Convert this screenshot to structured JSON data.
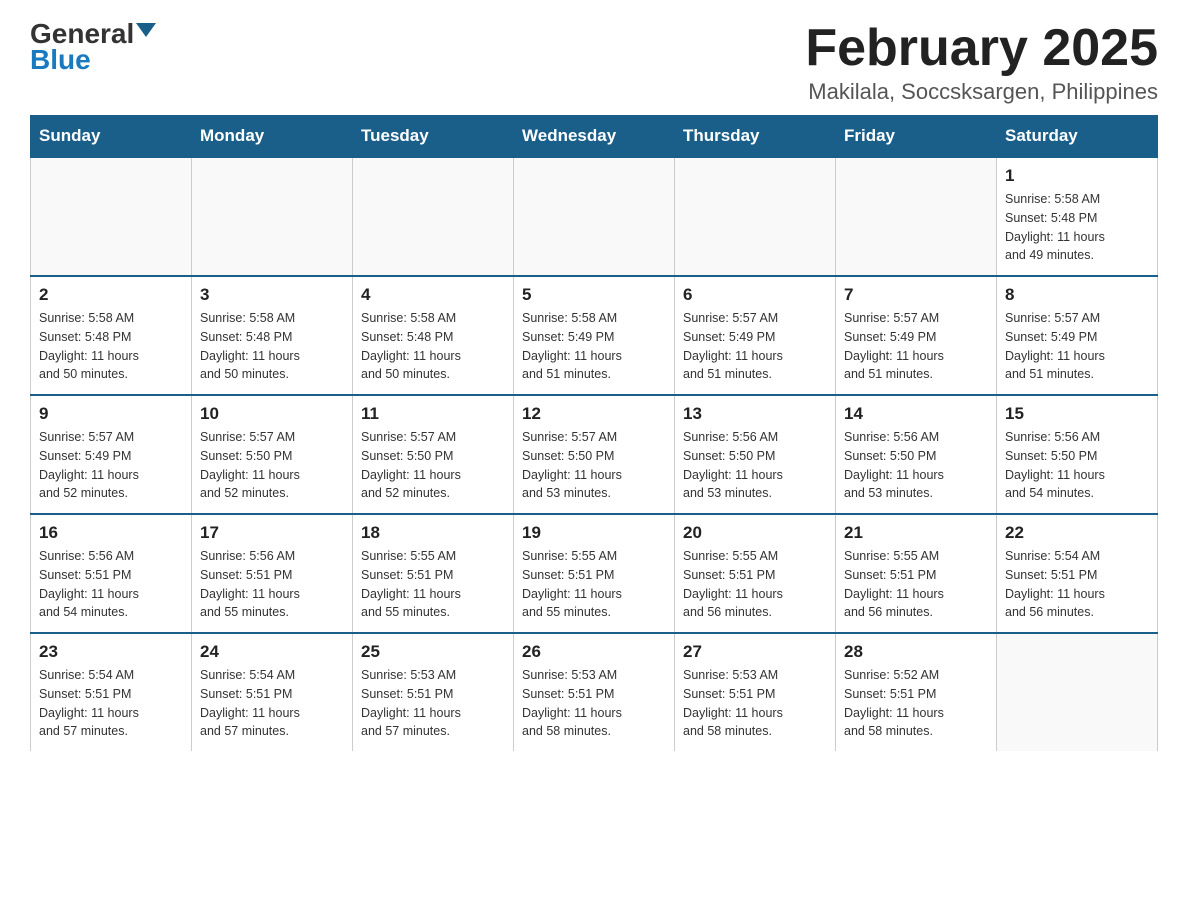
{
  "logo": {
    "general": "General",
    "blue": "Blue"
  },
  "title": "February 2025",
  "location": "Makilala, Soccsksargen, Philippines",
  "days_header": [
    "Sunday",
    "Monday",
    "Tuesday",
    "Wednesday",
    "Thursday",
    "Friday",
    "Saturday"
  ],
  "weeks": [
    [
      {
        "day": "",
        "info": ""
      },
      {
        "day": "",
        "info": ""
      },
      {
        "day": "",
        "info": ""
      },
      {
        "day": "",
        "info": ""
      },
      {
        "day": "",
        "info": ""
      },
      {
        "day": "",
        "info": ""
      },
      {
        "day": "1",
        "info": "Sunrise: 5:58 AM\nSunset: 5:48 PM\nDaylight: 11 hours\nand 49 minutes."
      }
    ],
    [
      {
        "day": "2",
        "info": "Sunrise: 5:58 AM\nSunset: 5:48 PM\nDaylight: 11 hours\nand 50 minutes."
      },
      {
        "day": "3",
        "info": "Sunrise: 5:58 AM\nSunset: 5:48 PM\nDaylight: 11 hours\nand 50 minutes."
      },
      {
        "day": "4",
        "info": "Sunrise: 5:58 AM\nSunset: 5:48 PM\nDaylight: 11 hours\nand 50 minutes."
      },
      {
        "day": "5",
        "info": "Sunrise: 5:58 AM\nSunset: 5:49 PM\nDaylight: 11 hours\nand 51 minutes."
      },
      {
        "day": "6",
        "info": "Sunrise: 5:57 AM\nSunset: 5:49 PM\nDaylight: 11 hours\nand 51 minutes."
      },
      {
        "day": "7",
        "info": "Sunrise: 5:57 AM\nSunset: 5:49 PM\nDaylight: 11 hours\nand 51 minutes."
      },
      {
        "day": "8",
        "info": "Sunrise: 5:57 AM\nSunset: 5:49 PM\nDaylight: 11 hours\nand 51 minutes."
      }
    ],
    [
      {
        "day": "9",
        "info": "Sunrise: 5:57 AM\nSunset: 5:49 PM\nDaylight: 11 hours\nand 52 minutes."
      },
      {
        "day": "10",
        "info": "Sunrise: 5:57 AM\nSunset: 5:50 PM\nDaylight: 11 hours\nand 52 minutes."
      },
      {
        "day": "11",
        "info": "Sunrise: 5:57 AM\nSunset: 5:50 PM\nDaylight: 11 hours\nand 52 minutes."
      },
      {
        "day": "12",
        "info": "Sunrise: 5:57 AM\nSunset: 5:50 PM\nDaylight: 11 hours\nand 53 minutes."
      },
      {
        "day": "13",
        "info": "Sunrise: 5:56 AM\nSunset: 5:50 PM\nDaylight: 11 hours\nand 53 minutes."
      },
      {
        "day": "14",
        "info": "Sunrise: 5:56 AM\nSunset: 5:50 PM\nDaylight: 11 hours\nand 53 minutes."
      },
      {
        "day": "15",
        "info": "Sunrise: 5:56 AM\nSunset: 5:50 PM\nDaylight: 11 hours\nand 54 minutes."
      }
    ],
    [
      {
        "day": "16",
        "info": "Sunrise: 5:56 AM\nSunset: 5:51 PM\nDaylight: 11 hours\nand 54 minutes."
      },
      {
        "day": "17",
        "info": "Sunrise: 5:56 AM\nSunset: 5:51 PM\nDaylight: 11 hours\nand 55 minutes."
      },
      {
        "day": "18",
        "info": "Sunrise: 5:55 AM\nSunset: 5:51 PM\nDaylight: 11 hours\nand 55 minutes."
      },
      {
        "day": "19",
        "info": "Sunrise: 5:55 AM\nSunset: 5:51 PM\nDaylight: 11 hours\nand 55 minutes."
      },
      {
        "day": "20",
        "info": "Sunrise: 5:55 AM\nSunset: 5:51 PM\nDaylight: 11 hours\nand 56 minutes."
      },
      {
        "day": "21",
        "info": "Sunrise: 5:55 AM\nSunset: 5:51 PM\nDaylight: 11 hours\nand 56 minutes."
      },
      {
        "day": "22",
        "info": "Sunrise: 5:54 AM\nSunset: 5:51 PM\nDaylight: 11 hours\nand 56 minutes."
      }
    ],
    [
      {
        "day": "23",
        "info": "Sunrise: 5:54 AM\nSunset: 5:51 PM\nDaylight: 11 hours\nand 57 minutes."
      },
      {
        "day": "24",
        "info": "Sunrise: 5:54 AM\nSunset: 5:51 PM\nDaylight: 11 hours\nand 57 minutes."
      },
      {
        "day": "25",
        "info": "Sunrise: 5:53 AM\nSunset: 5:51 PM\nDaylight: 11 hours\nand 57 minutes."
      },
      {
        "day": "26",
        "info": "Sunrise: 5:53 AM\nSunset: 5:51 PM\nDaylight: 11 hours\nand 58 minutes."
      },
      {
        "day": "27",
        "info": "Sunrise: 5:53 AM\nSunset: 5:51 PM\nDaylight: 11 hours\nand 58 minutes."
      },
      {
        "day": "28",
        "info": "Sunrise: 5:52 AM\nSunset: 5:51 PM\nDaylight: 11 hours\nand 58 minutes."
      },
      {
        "day": "",
        "info": ""
      }
    ]
  ]
}
